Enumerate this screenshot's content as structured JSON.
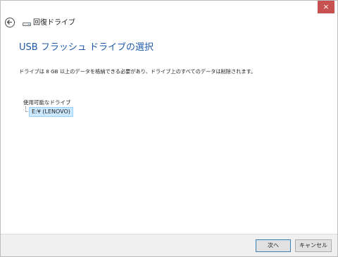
{
  "window": {
    "close_glyph": "×"
  },
  "header": {
    "title": "回復ドライブ",
    "back_icon": "back-arrow-icon",
    "drive_icon": "drive-icon"
  },
  "page": {
    "heading": "USB フラッシュ ドライブの選択",
    "description": "ドライブは 8 GB 以上のデータを格納できる必要があり、ドライブ上のすべてのデータは削除されます。"
  },
  "drives": {
    "label": "使用可能なドライブ",
    "items": [
      {
        "label": "E:¥ (LENOVO)",
        "selected": true
      }
    ]
  },
  "footer": {
    "next_label": "次へ",
    "cancel_label": "キャンセル"
  },
  "colors": {
    "heading": "#1e5aa8",
    "close": "#c75050",
    "selection": "#cce8ff",
    "footer": "#f0f0f0"
  }
}
